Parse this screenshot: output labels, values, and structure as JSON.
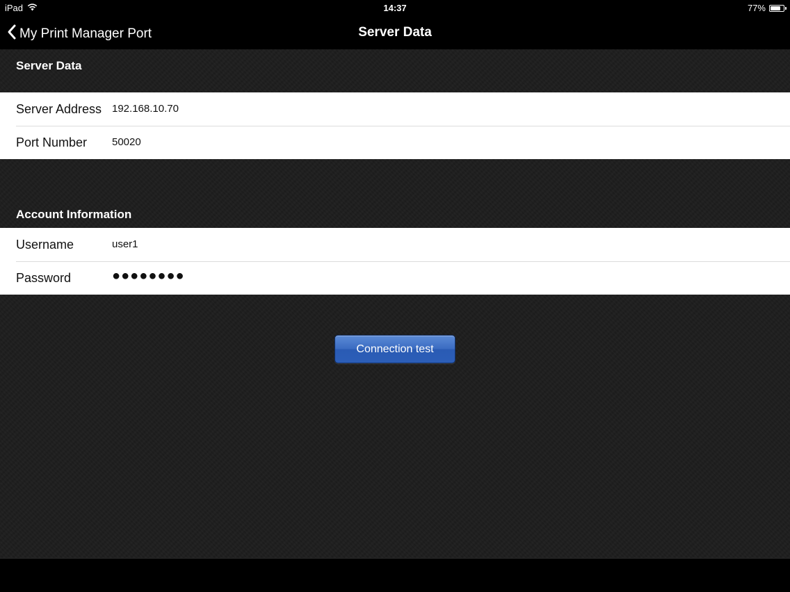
{
  "status_bar": {
    "device": "iPad",
    "time": "14:37",
    "battery_percent": "77%",
    "battery_level": 0.77
  },
  "nav": {
    "back_label": "My Print Manager Port",
    "title": "Server Data"
  },
  "server_section": {
    "header": "Server Data",
    "rows": [
      {
        "label": "Server Address",
        "value": "192.168.10.70"
      },
      {
        "label": "Port Number",
        "value": "50020"
      }
    ]
  },
  "account_section": {
    "header": "Account Information",
    "rows": [
      {
        "label": "Username",
        "value": "user1"
      },
      {
        "label": "Password",
        "value": "●●●●●●●●"
      }
    ]
  },
  "connection_button": {
    "label": "Connection test"
  },
  "colors": {
    "button_blue": "#3b6cc2",
    "background": "#1e1e1e",
    "bar": "#000000"
  }
}
